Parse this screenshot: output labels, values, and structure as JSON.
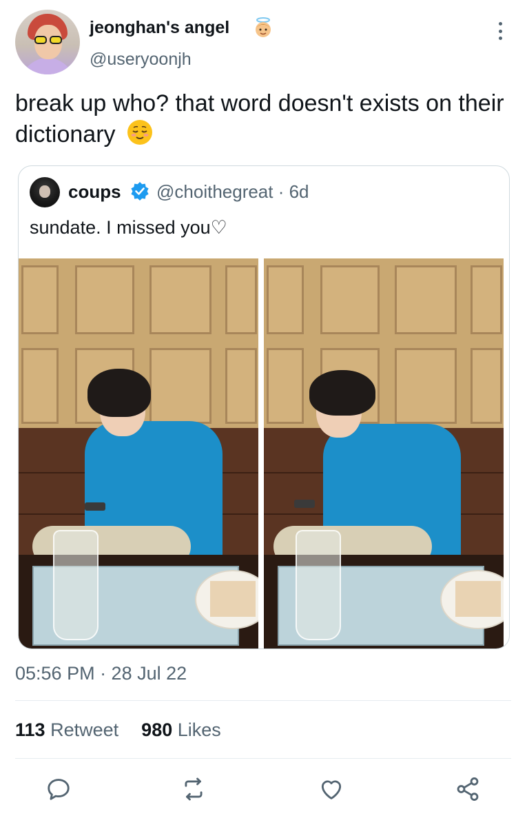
{
  "author": {
    "display_name": "jeonghan's angel",
    "handle": "@useryoonjh",
    "name_emoji": "baby-angel-emoji"
  },
  "tweet": {
    "text": "break up who? that word doesn't exists on their dictionary",
    "emoji": "relieved-face-emoji"
  },
  "quote": {
    "name": "coups",
    "verified": true,
    "handle_time": "@choithegreat · 6d",
    "text": "sundate. I missed you♡"
  },
  "timestamp": "05:56 PM · 28 Jul 22",
  "stats": {
    "retweets_count": "113",
    "retweets_label": "Retweet",
    "likes_count": "980",
    "likes_label": "Likes"
  },
  "actions": {
    "reply_icon": "reply-icon",
    "retweet_icon": "retweet-icon",
    "like_icon": "like-icon",
    "share_icon": "share-icon"
  },
  "colors": {
    "text_primary": "#0f1419",
    "text_secondary": "#536471",
    "border": "#cfd9de",
    "verified_blue": "#1d9bf0"
  }
}
